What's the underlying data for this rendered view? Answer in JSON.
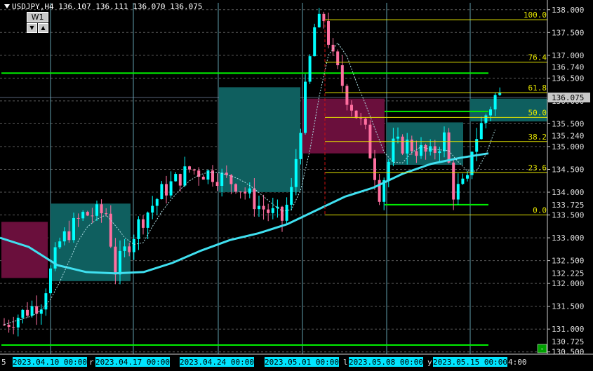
{
  "header": {
    "symbol": "USDJPY,H4",
    "ohlc": "136.107 136.111 136.070 136.075"
  },
  "widget": {
    "label": "W1",
    "down": "▼",
    "up": "▲"
  },
  "colors": {
    "bg": "#000000",
    "grid": "#5a5a5a",
    "vgrid": "#7fd3e6",
    "bull": "#00ffff",
    "bear": "#ff6fa0",
    "green_level": "#00ee00",
    "fib": "#e6e600",
    "demand_zone": "#0f5f5f",
    "supply_zone": "#6a0f3c",
    "ma_slow": "#40e0f0",
    "current_price_bg": "#c8c8c8"
  },
  "chart_data": {
    "type": "candlestick",
    "symbol": "USDJPY",
    "timeframe": "H4",
    "ylim": [
      130.45,
      138.15
    ],
    "y_ticks": [
      "138.000",
      "137.500",
      "137.000",
      "136.500",
      "136.000",
      "135.500",
      "135.000",
      "134.500",
      "134.000",
      "133.500",
      "133.000",
      "132.500",
      "132.000",
      "131.500",
      "131.000",
      "130.500"
    ],
    "y_tick_values": [
      138.0,
      137.5,
      137.0,
      136.5,
      136.0,
      135.5,
      135.0,
      134.5,
      134.0,
      133.5,
      133.0,
      132.5,
      132.0,
      131.5,
      131.0,
      130.5
    ],
    "price_labels": [
      {
        "text": "136.740",
        "value": 136.74
      },
      {
        "text": "136.075",
        "value": 136.075,
        "current": true
      },
      {
        "text": "135.240",
        "value": 135.24
      },
      {
        "text": "133.725",
        "value": 133.725
      },
      {
        "text": "132.225",
        "value": 132.225
      },
      {
        "text": "130.725",
        "value": 130.725
      }
    ],
    "x_labels": [
      "2023.04.10 00:00",
      "2023.04.17 00:00",
      "2023.04.24 00:00",
      "2023.05.01 00:00",
      "2023.05.08 00:00",
      "2023.05.15 00:00"
    ],
    "x_edge_labels": {
      "left": "5",
      "right": "4:00"
    },
    "x_label_gaps": [
      "r",
      "",
      "",
      "l",
      "y"
    ],
    "fib_levels": [
      {
        "label": "100.0",
        "price": 137.78
      },
      {
        "label": "76.4",
        "price": 136.85
      },
      {
        "label": "61.8",
        "price": 136.18
      },
      {
        "label": "50.0",
        "price": 135.64
      },
      {
        "label": "38.2",
        "price": 135.11
      },
      {
        "label": "23.6",
        "price": 134.43
      },
      {
        "label": "0.0",
        "price": 133.5
      }
    ],
    "green_levels": [
      136.61,
      130.65
    ],
    "short_green_levels": [
      135.77,
      133.725
    ],
    "zones": [
      {
        "type": "supply",
        "from": 133.35,
        "to": 132.12
      },
      {
        "type": "demand",
        "from": 133.75,
        "to": 132.05
      },
      {
        "type": "demand",
        "from": 136.3,
        "to": 134.0
      },
      {
        "type": "supply",
        "from": 136.05,
        "to": 134.85
      },
      {
        "type": "demand",
        "from": 135.53,
        "to": 134.6
      },
      {
        "type": "demand",
        "from": 136.05,
        "to": 135.55
      }
    ],
    "ma_slow": [
      133.0,
      132.8,
      132.4,
      132.25,
      132.22,
      132.25,
      132.45,
      132.72,
      132.95,
      133.1,
      133.3,
      133.6,
      133.9,
      134.1,
      134.4,
      134.62,
      134.75,
      134.85
    ],
    "anchors": [
      [
        0,
        131.1
      ],
      [
        8,
        131.6
      ],
      [
        12,
        132.9
      ],
      [
        17,
        133.5
      ],
      [
        22,
        133.55
      ],
      [
        24,
        132.3
      ],
      [
        29,
        133.3
      ],
      [
        34,
        134.0
      ],
      [
        40,
        134.5
      ],
      [
        45,
        134.4
      ],
      [
        50,
        134.2
      ],
      [
        55,
        133.7
      ],
      [
        60,
        133.4
      ],
      [
        62,
        134.0
      ],
      [
        64,
        135.5
      ],
      [
        67,
        137.6
      ],
      [
        69,
        137.8
      ],
      [
        71,
        136.9
      ],
      [
        74,
        136.1
      ],
      [
        78,
        135.3
      ],
      [
        81,
        134.0
      ],
      [
        84,
        135.0
      ],
      [
        87,
        135.05
      ],
      [
        92,
        134.8
      ],
      [
        95,
        135.2
      ],
      [
        97,
        134.0
      ],
      [
        100,
        134.2
      ],
      [
        101,
        135.0
      ],
      [
        104,
        135.7
      ],
      [
        106,
        136.1
      ],
      [
        107,
        136.1
      ]
    ]
  }
}
